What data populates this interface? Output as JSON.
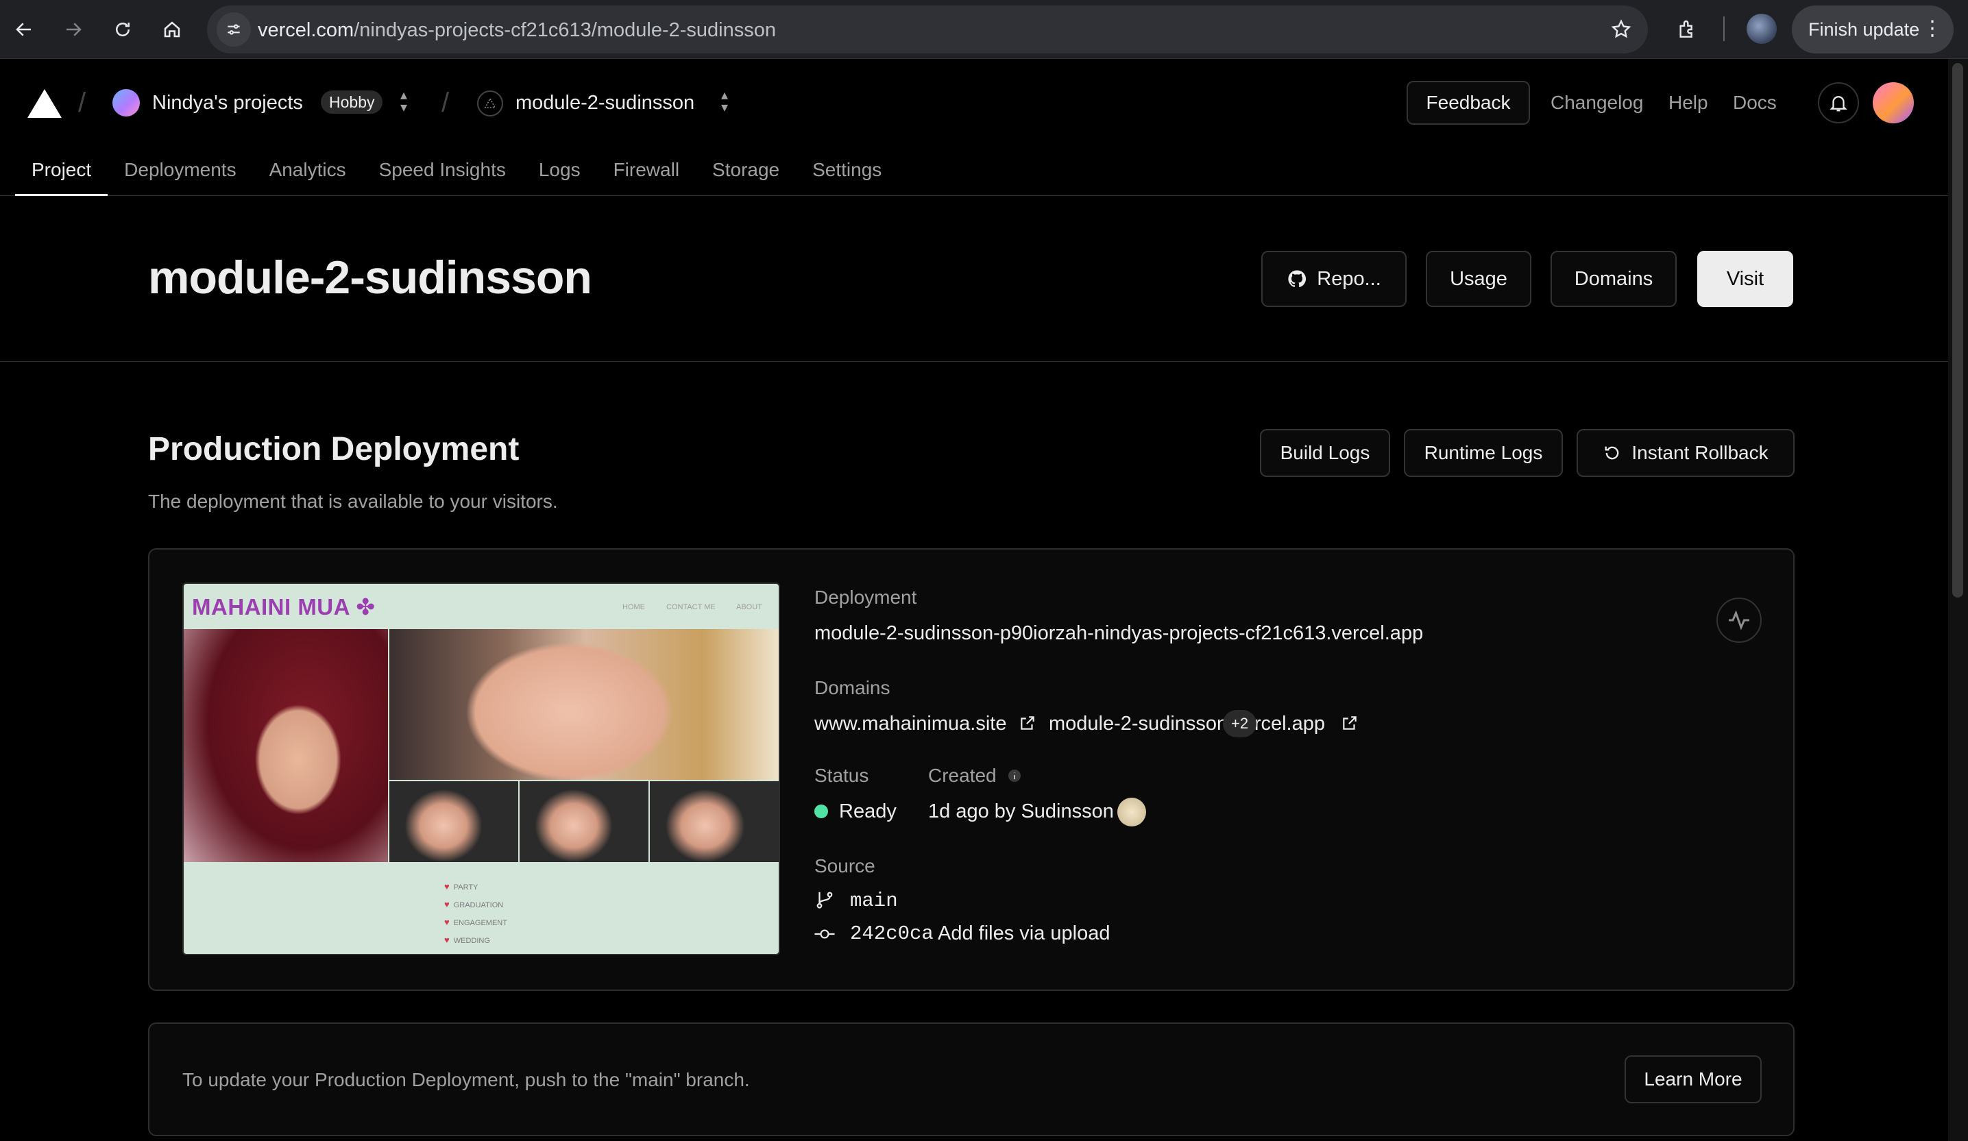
{
  "browser": {
    "url_host": "vercel.com",
    "url_path": "/nindyas-projects-cf21c613/module-2-sudinsson",
    "finish_update": "Finish update"
  },
  "header": {
    "team_name": "Nindya's projects",
    "plan_badge": "Hobby",
    "project_name": "module-2-sudinsson",
    "feedback": "Feedback",
    "links": [
      "Changelog",
      "Help",
      "Docs"
    ]
  },
  "tabs": [
    "Project",
    "Deployments",
    "Analytics",
    "Speed Insights",
    "Logs",
    "Firewall",
    "Storage",
    "Settings"
  ],
  "project": {
    "title": "module-2-sudinsson",
    "repo_button": "Repo...",
    "usage_button": "Usage",
    "domains_button": "Domains",
    "visit_button": "Visit"
  },
  "production": {
    "title": "Production Deployment",
    "subtitle": "The deployment that is available to your visitors.",
    "build_logs": "Build Logs",
    "runtime_logs": "Runtime Logs",
    "instant_rollback": "Instant Rollback"
  },
  "preview": {
    "brand": "MAHAINI MUA",
    "nav": [
      "HOME",
      "CONTACT ME",
      "ABOUT"
    ],
    "services": [
      "PARTY",
      "GRADUATION",
      "ENGAGEMENT",
      "WEDDING"
    ]
  },
  "deployment": {
    "deployment_label": "Deployment",
    "deployment_url": "module-2-sudinsson-p90iorzah-nindyas-projects-cf21c613.vercel.app",
    "domains_label": "Domains",
    "domain_1": "www.mahainimua.site",
    "domain_2": "module-2-sudinsson.vercel.app",
    "more_domains": "+2",
    "status_label": "Status",
    "status_value": "Ready",
    "created_label": "Created",
    "created_value": "1d ago by Sudinsson",
    "source_label": "Source",
    "branch": "main",
    "commit_hash": "242c0ca",
    "commit_message": "Add files via upload"
  },
  "note": {
    "text": "To update your Production Deployment, push to the \"main\" branch.",
    "learn_more": "Learn More"
  },
  "colors": {
    "background": "#000000",
    "ready": "#50e3a4",
    "brand_purple": "#9b3fb0"
  }
}
